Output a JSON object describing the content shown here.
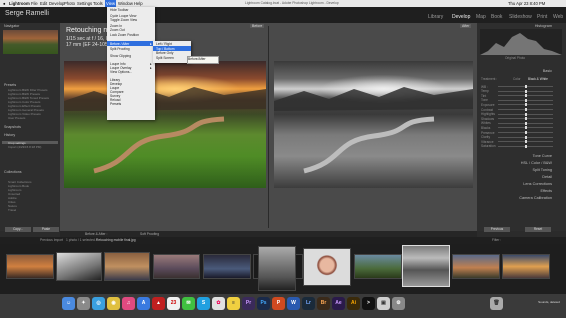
{
  "menubar": {
    "apple": "",
    "items": [
      "Lightroom",
      "File",
      "Edit",
      "Develop",
      "Photo",
      "Settings",
      "Tools",
      "View",
      "Window",
      "Help"
    ],
    "title": "Lightroom Catalog.lrcat - Adobe Photoshop Lightroom - Develop",
    "clock": "Thu Apr 23  8:40 PM"
  },
  "identity": "Serge Ramelli",
  "modules": [
    "Library",
    "Develop",
    "Map",
    "Book",
    "Slideshow",
    "Print",
    "Web"
  ],
  "left_panel": {
    "headers": {
      "navigator": "Navigator",
      "presets": "Presets",
      "snapshots": "Snapshots",
      "history": "History",
      "collections": "Collections"
    },
    "preset_rows": [
      "Lightroom B&W Filter Presets",
      "Lightroom B&W Presets",
      "Lightroom B&W Toned Presets",
      "Lightroom Color Presets",
      "Lightroom Effect Presets",
      "Lightroom General Presets",
      "Lightroom Video Presets",
      "User Presets"
    ],
    "history_rows": [
      "Crop settings",
      "Import (4/23/15 8:18 PM)"
    ],
    "collection_rows": [
      "Smart Collections",
      "Lightroom Book",
      "Lightroom",
      "Unsorted",
      "Adobe",
      "Cities",
      "Nature",
      "Travel"
    ],
    "copy_label": "Copy...",
    "paste_label": "Paste"
  },
  "overlay": {
    "title": "Retouching m",
    "line1": "1/15 sec at f / 16, ISO 100",
    "line2": "17 mm (EF 24-105mm)"
  },
  "pane_tags": {
    "before": "Before",
    "after": "After"
  },
  "view_menu": {
    "items": [
      {
        "label": "Hide Toolbar",
        "key": "T"
      },
      {
        "label": "Cycle Loupe View",
        "key": ""
      },
      {
        "label": "Toggle Zoom View",
        "key": ""
      },
      {
        "label": "Zoom In",
        "key": ""
      },
      {
        "label": "Zoom Out",
        "key": ""
      },
      {
        "label": "Lock Zoom Position",
        "key": ""
      },
      {
        "label": "Before / After",
        "key": "",
        "sub": true
      },
      {
        "label": "Split Proofing",
        "key": ""
      },
      {
        "label": "Show Clipping",
        "key": "J"
      },
      {
        "label": "Loupe Info",
        "key": "",
        "sub": true
      },
      {
        "label": "Loupe Overlay",
        "key": "",
        "sub": true
      },
      {
        "label": "View Options...",
        "key": ""
      },
      {
        "label": "Library",
        "key": "G"
      },
      {
        "label": "Develop",
        "key": "D"
      },
      {
        "label": "Loupe",
        "key": "E"
      },
      {
        "label": "Compare",
        "key": "C"
      },
      {
        "label": "Survey",
        "key": "N"
      },
      {
        "label": "Reload",
        "key": ""
      },
      {
        "label": "Presets",
        "key": ""
      }
    ]
  },
  "before_after_menu": {
    "items": [
      "Left / Right",
      "Top / Bottom",
      "Before Only",
      "Split Screen"
    ],
    "selected": "Top / Bottom"
  },
  "tooltip": "Before/After",
  "right_panel": {
    "histogram": "Histogram",
    "original_photo": "Original Photo",
    "tools": [
      "Crop",
      "Spot",
      "Red Eye",
      "Graduated",
      "Radial",
      "Brush"
    ],
    "basic": "Basic",
    "treatment_label": "Treatment :",
    "color": "Color",
    "bw": "Black & White",
    "sliders": [
      {
        "label": "WB :",
        "value": 0.5
      },
      {
        "label": "Temp",
        "value": 0.5
      },
      {
        "label": "Tint",
        "value": 0.5
      },
      {
        "label": "Tone",
        "value": 0.5
      },
      {
        "label": "Exposure",
        "value": 0.5
      },
      {
        "label": "Contrast",
        "value": 0.5
      },
      {
        "label": "Highlights",
        "value": 0.5
      },
      {
        "label": "Shadows",
        "value": 0.5
      },
      {
        "label": "Whites",
        "value": 0.5
      },
      {
        "label": "Blacks",
        "value": 0.5
      },
      {
        "label": "Presence",
        "value": 0.5
      },
      {
        "label": "Clarity",
        "value": 0.5
      },
      {
        "label": "Vibrance",
        "value": 0.5
      },
      {
        "label": "Saturation",
        "value": 0.5
      }
    ],
    "sections": [
      "Tone Curve",
      "HSL / Color / B&W",
      "Split Toning",
      "Detail",
      "Lens Corrections",
      "Effects",
      "Camera Calibration"
    ],
    "previous_label": "Previous",
    "reset_label": "Reset"
  },
  "toolbar": {
    "before_after": "Before & After :",
    "soft_proofing": "Soft Proofing"
  },
  "filmstrip_header": {
    "left": "Previous Import",
    "count": "1 photo / 1 selected /",
    "filename": "Retouching mobile final.jpg",
    "filter": "Filter :"
  },
  "thumbnails": [
    {
      "name": "sunset-city"
    },
    {
      "name": "bridge-bw"
    },
    {
      "name": "bridge-color"
    },
    {
      "name": "cityscape-dusk"
    },
    {
      "name": "skyline-night"
    },
    {
      "name": "portrait-man"
    },
    {
      "name": "flatiron-bw"
    },
    {
      "name": "portrait-woman"
    },
    {
      "name": "landscape-green"
    },
    {
      "name": "landscape-bw",
      "selected": true
    },
    {
      "name": "landscape-sunset"
    },
    {
      "name": "city-sunset"
    }
  ],
  "dock": {
    "icons": [
      "finder",
      "launchpad",
      "safari",
      "chrome",
      "itunes",
      "app-store",
      "acrobat",
      "calendar",
      "messages",
      "skype",
      "photos",
      "notes",
      "premiere",
      "photoshop",
      "powerpoint",
      "word",
      "lightroom",
      "bridge",
      "after-effects",
      "illustrator",
      "terminal",
      "preview",
      "system-prefs",
      "trash"
    ],
    "badge": "Sounds, deleted"
  }
}
